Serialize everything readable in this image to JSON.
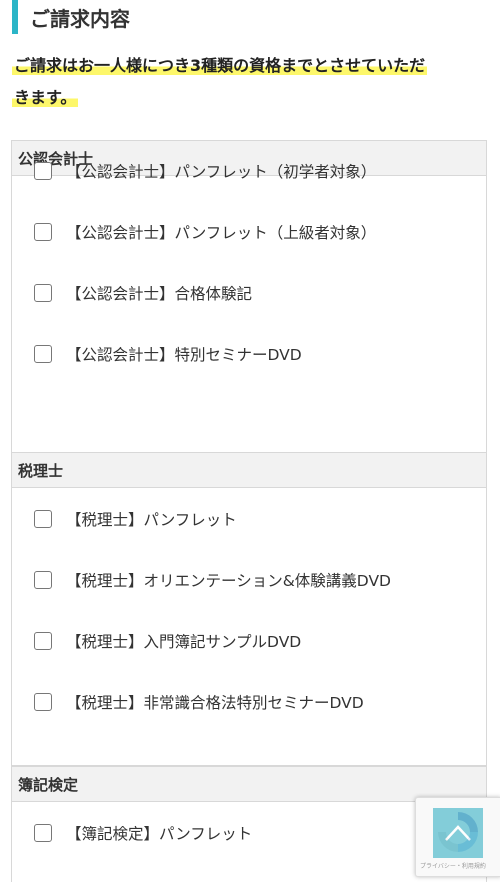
{
  "heading": "ご請求内容",
  "notice": {
    "line1": "ご請求はお一人様につき3種類の資格までとさせていただ",
    "line2": "きます。"
  },
  "groups": [
    {
      "title": "公認会計士",
      "items": [
        "【公認会計士】パンフレット（初学者対象）",
        "【公認会計士】パンフレット（上級者対象）",
        "【公認会計士】合格体験記",
        "【公認会計士】特別セミナーDVD"
      ]
    },
    {
      "title": "税理士",
      "items": [
        "【税理士】パンフレット",
        "【税理士】オリエンテーション&体験講義DVD",
        "【税理士】入門簿記サンプルDVD",
        "【税理士】非常識合格法特別セミナーDVD"
      ]
    },
    {
      "title": "簿記検定",
      "items": [
        "【簿記検定】パンフレット"
      ]
    }
  ],
  "recaptcha": {
    "privacy_text": "プライバシー・利用規約"
  },
  "colors": {
    "accent": "#2bb5c7",
    "highlight": "#fdf76a",
    "scroll_top": "#6fc6d4"
  }
}
